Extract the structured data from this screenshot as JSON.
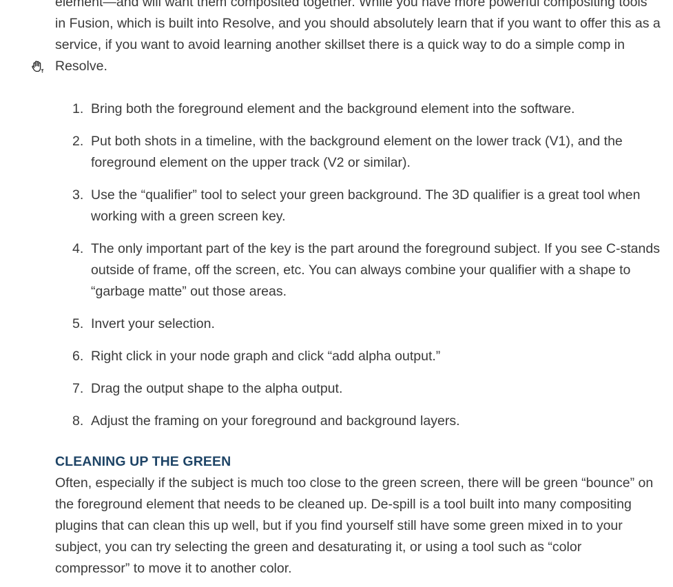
{
  "intro": {
    "text": "element—and will want them composited together. While you have more powerful compositing tools in Fusion, which is built into Resolve, and you should absolutely learn that if you want to offer this as a service, if you want to avoid learning another skillset there is a quick way to do a simple comp in Resolve."
  },
  "cursor": {
    "icon": "grab-hand-cursor-icon"
  },
  "steps": [
    {
      "num": "1.",
      "text": "Bring both the foreground element and the background element into the software."
    },
    {
      "num": "2.",
      "text": "Put both shots in a timeline, with the background element on the lower track (V1), and the foreground element on the upper track (V2 or similar)."
    },
    {
      "num": "3.",
      "text": "Use the “qualifier” tool to select your green background. The 3D qualifier is a great tool when working with a green screen key."
    },
    {
      "num": "4.",
      "text": "The only important part of the key is the part around the foreground subject. If you see C-stands outside of frame, off the screen, etc. You can always combine your qualifier with a shape to “garbage matte” out those areas."
    },
    {
      "num": "5.",
      "text": "Invert your selection."
    },
    {
      "num": "6.",
      "text": "Right click in your node graph and click “add alpha output.”"
    },
    {
      "num": "7.",
      "text": "Drag the output shape to the alpha output."
    },
    {
      "num": "8.",
      "text": "Adjust the framing on your foreground and background layers."
    }
  ],
  "section": {
    "heading": "CLEANING UP THE GREEN",
    "body": "Often, especially if the subject is much too close to the green screen, there will be green “bounce” on the foreground element that needs to be cleaned up. De-spill is a tool built into many compositing plugins that can clean this up well, but if you find yourself still have some green mixed in to your subject, you can try selecting the green and desaturating it, or using a tool such as “color compressor” to move it to another color."
  },
  "colors": {
    "text": "#3a3a3a",
    "heading": "#1e4466",
    "background": "#ffffff"
  }
}
